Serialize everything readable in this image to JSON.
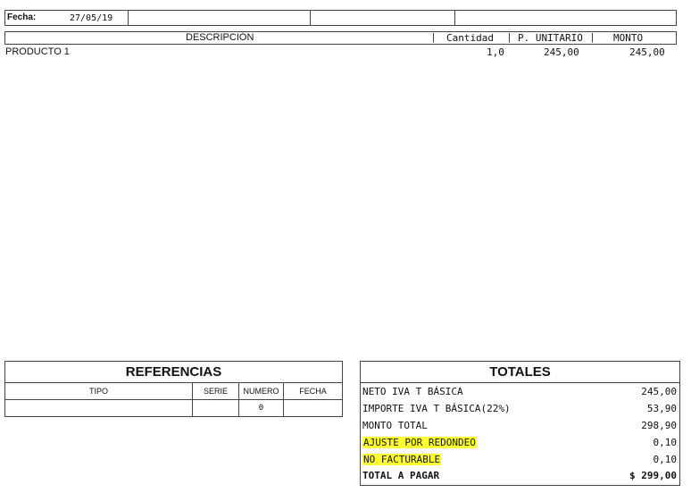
{
  "header": {
    "fecha_label": "Fecha:",
    "fecha_value": "27/05/19"
  },
  "items": {
    "columns": {
      "descripcion": "DESCRIPCIÓN",
      "cantidad": "Cantidad",
      "unitario": "P. UNITARIO",
      "monto": "MONTO"
    },
    "rows": [
      {
        "descripcion": "PRODUCTO 1",
        "cantidad": "1,0",
        "unitario": "245,00",
        "monto": "245,00"
      }
    ]
  },
  "referencias": {
    "title": "REFERENCIAS",
    "columns": {
      "tipo": "TIPO",
      "serie": "SERIE",
      "numero": "NUMERO",
      "fecha": "FECHA"
    },
    "row": {
      "tipo": "",
      "serie": "",
      "numero": "0",
      "fecha": ""
    }
  },
  "totales": {
    "title": "TOTALES",
    "rows": [
      {
        "label": "NETO IVA T BÁSICA",
        "amount": "245,00"
      },
      {
        "label": "IMPORTE IVA T BÁSICA(22%)",
        "amount": "53,90"
      },
      {
        "label": "MONTO TOTAL",
        "amount": "298,90"
      },
      {
        "label": "AJUSTE POR REDONDEO",
        "amount": "0,10"
      },
      {
        "label": "NO FACTURABLE",
        "amount": "0,10"
      },
      {
        "label": "TOTAL A PAGAR",
        "amount": "$ 299,00"
      }
    ],
    "highlight_color": "#ffff33"
  }
}
